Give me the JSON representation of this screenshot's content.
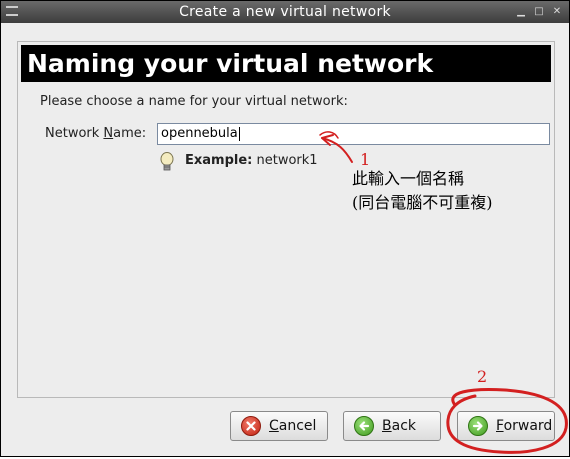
{
  "window": {
    "title": "Create a new virtual network"
  },
  "header": {
    "title": "Naming your virtual network"
  },
  "form": {
    "prompt": "Please choose a name for your virtual network:",
    "label_prefix": "Network ",
    "label_underline": "N",
    "label_suffix": "ame:",
    "network_name_value": "opennebula",
    "example_label": "Example:",
    "example_value": "network1"
  },
  "buttons": {
    "cancel_underline": "C",
    "cancel_rest": "ancel",
    "back_underline": "B",
    "back_rest": "ack",
    "forward_underline": "F",
    "forward_rest": "orward"
  },
  "annotations": {
    "number_1": "1",
    "note_line1": "此輸入一個名稱",
    "note_line2": "(同台電腦不可重複)",
    "number_2": "2",
    "color": "#d32020"
  },
  "icons": {
    "window_menu": "window-menu-icon",
    "minimize": "minimize-icon",
    "maximize": "maximize-icon",
    "close": "close-icon",
    "hint": "lightbulb-icon",
    "cancel": "cancel-icon",
    "back": "back-arrow-icon",
    "forward": "forward-arrow-icon"
  }
}
